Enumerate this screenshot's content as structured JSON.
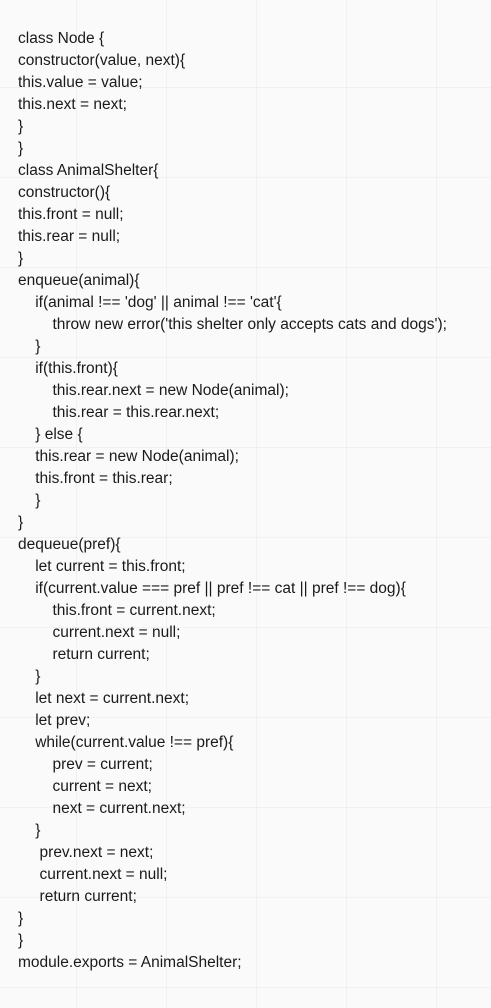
{
  "code_lines": [
    "class Node {",
    "constructor(value, next){",
    "this.value = value;",
    "this.next = next;",
    "}",
    "}",
    "class AnimalShelter{",
    "constructor(){",
    "this.front = null;",
    "this.rear = null;",
    "}",
    "enqueue(animal){",
    "    if(animal !== 'dog' || animal !== 'cat'{",
    "        throw new error('this shelter only accepts cats and dogs');",
    "    }",
    "    if(this.front){",
    "        this.rear.next = new Node(animal);",
    "        this.rear = this.rear.next;",
    "    } else {",
    "    this.rear = new Node(animal);",
    "    this.front = this.rear;",
    "    }",
    "}",
    "dequeue(pref){",
    "    let current = this.front;",
    "    if(current.value === pref || pref !== cat || pref !== dog){",
    "        this.front = current.next;",
    "        current.next = null;",
    "        return current;",
    "    }",
    "    let next = current.next;",
    "    let prev;",
    "    while(current.value !== pref){",
    "        prev = current;",
    "        current = next;",
    "        next = current.next;",
    "    }",
    "     prev.next = next;",
    "     current.next = null;",
    "     return current;",
    "}",
    "}",
    "module.exports = AnimalShelter;"
  ]
}
